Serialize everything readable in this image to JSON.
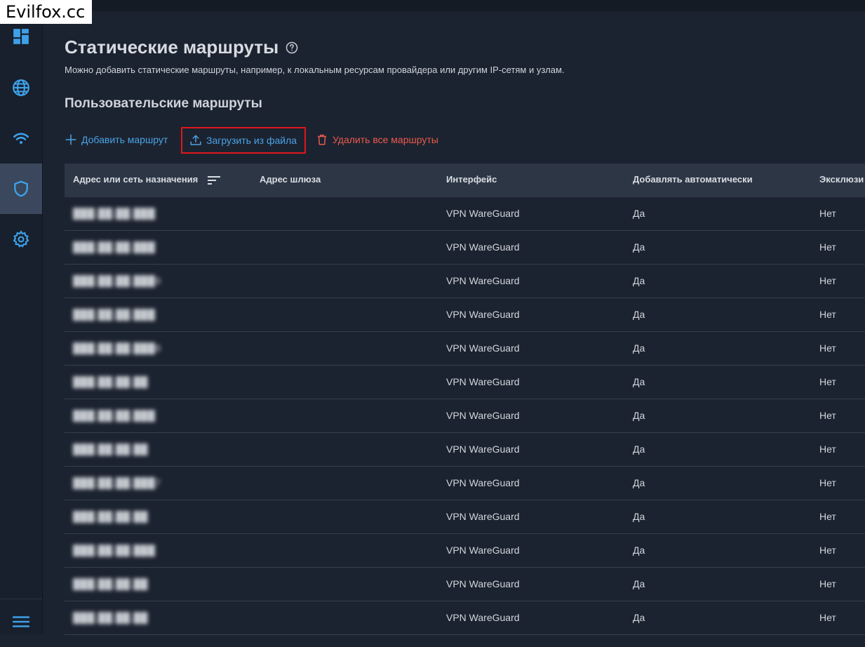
{
  "watermark": "Evilfox.cc",
  "sidebar": {
    "items": [
      {
        "name": "dashboard",
        "icon": "dashboard-icon"
      },
      {
        "name": "internet",
        "icon": "globe-icon"
      },
      {
        "name": "wifi",
        "icon": "wifi-icon"
      },
      {
        "name": "security",
        "icon": "shield-icon",
        "active": true
      },
      {
        "name": "settings",
        "icon": "gear-icon"
      },
      {
        "name": "menu",
        "icon": "hamburger-icon"
      }
    ],
    "accent": "#3ea0e8"
  },
  "page": {
    "title": "Статические маршруты",
    "description": "Можно добавить статические маршруты, например, к локальным ресурсам провайдера или другим IP-сетям и узлам.",
    "section_title": "Пользовательские маршруты"
  },
  "toolbar": {
    "add_label": "Добавить маршрут",
    "upload_label": "Загрузить из файла",
    "delete_label": "Удалить все маршруты",
    "add_color": "#4aa3e6",
    "delete_color": "#ea5a4c",
    "highlight_color": "#e0161b"
  },
  "table": {
    "headers": [
      "Адрес или сеть назначения",
      "Адрес шлюза",
      "Интерфейс",
      "Добавлять автоматически",
      "Эксклюзи"
    ],
    "rows": [
      {
        "dest": "███.██.██.███",
        "gateway": "",
        "interface": "VPN WareGuard",
        "auto": "Да",
        "exclusive": "Нет"
      },
      {
        "dest": "███.██.██.███",
        "gateway": "",
        "interface": "VPN WareGuard",
        "auto": "Да",
        "exclusive": "Нет"
      },
      {
        "dest": "███.██.██.███9",
        "gateway": "",
        "interface": "VPN WareGuard",
        "auto": "Да",
        "exclusive": "Нет"
      },
      {
        "dest": "███.██.██.███",
        "gateway": "",
        "interface": "VPN WareGuard",
        "auto": "Да",
        "exclusive": "Нет"
      },
      {
        "dest": "███.██.██.███8",
        "gateway": "",
        "interface": "VPN WareGuard",
        "auto": "Да",
        "exclusive": "Нет"
      },
      {
        "dest": "███.██.██.██",
        "gateway": "",
        "interface": "VPN WareGuard",
        "auto": "Да",
        "exclusive": "Нет"
      },
      {
        "dest": "███.██.██.███",
        "gateway": "",
        "interface": "VPN WareGuard",
        "auto": "Да",
        "exclusive": "Нет"
      },
      {
        "dest": "███.██.██.██",
        "gateway": "",
        "interface": "VPN WareGuard",
        "auto": "Да",
        "exclusive": "Нет"
      },
      {
        "dest": "███.██.██.███7",
        "gateway": "",
        "interface": "VPN WareGuard",
        "auto": "Да",
        "exclusive": "Нет"
      },
      {
        "dest": "███.██.██.██",
        "gateway": "",
        "interface": "VPN WareGuard",
        "auto": "Да",
        "exclusive": "Нет"
      },
      {
        "dest": "███.██.██.███",
        "gateway": "",
        "interface": "VPN WareGuard",
        "auto": "Да",
        "exclusive": "Нет"
      },
      {
        "dest": "███.██.██.██",
        "gateway": "",
        "interface": "VPN WareGuard",
        "auto": "Да",
        "exclusive": "Нет"
      },
      {
        "dest": "███.██.██.██",
        "gateway": "",
        "interface": "VPN WareGuard",
        "auto": "Да",
        "exclusive": "Нет"
      }
    ]
  }
}
